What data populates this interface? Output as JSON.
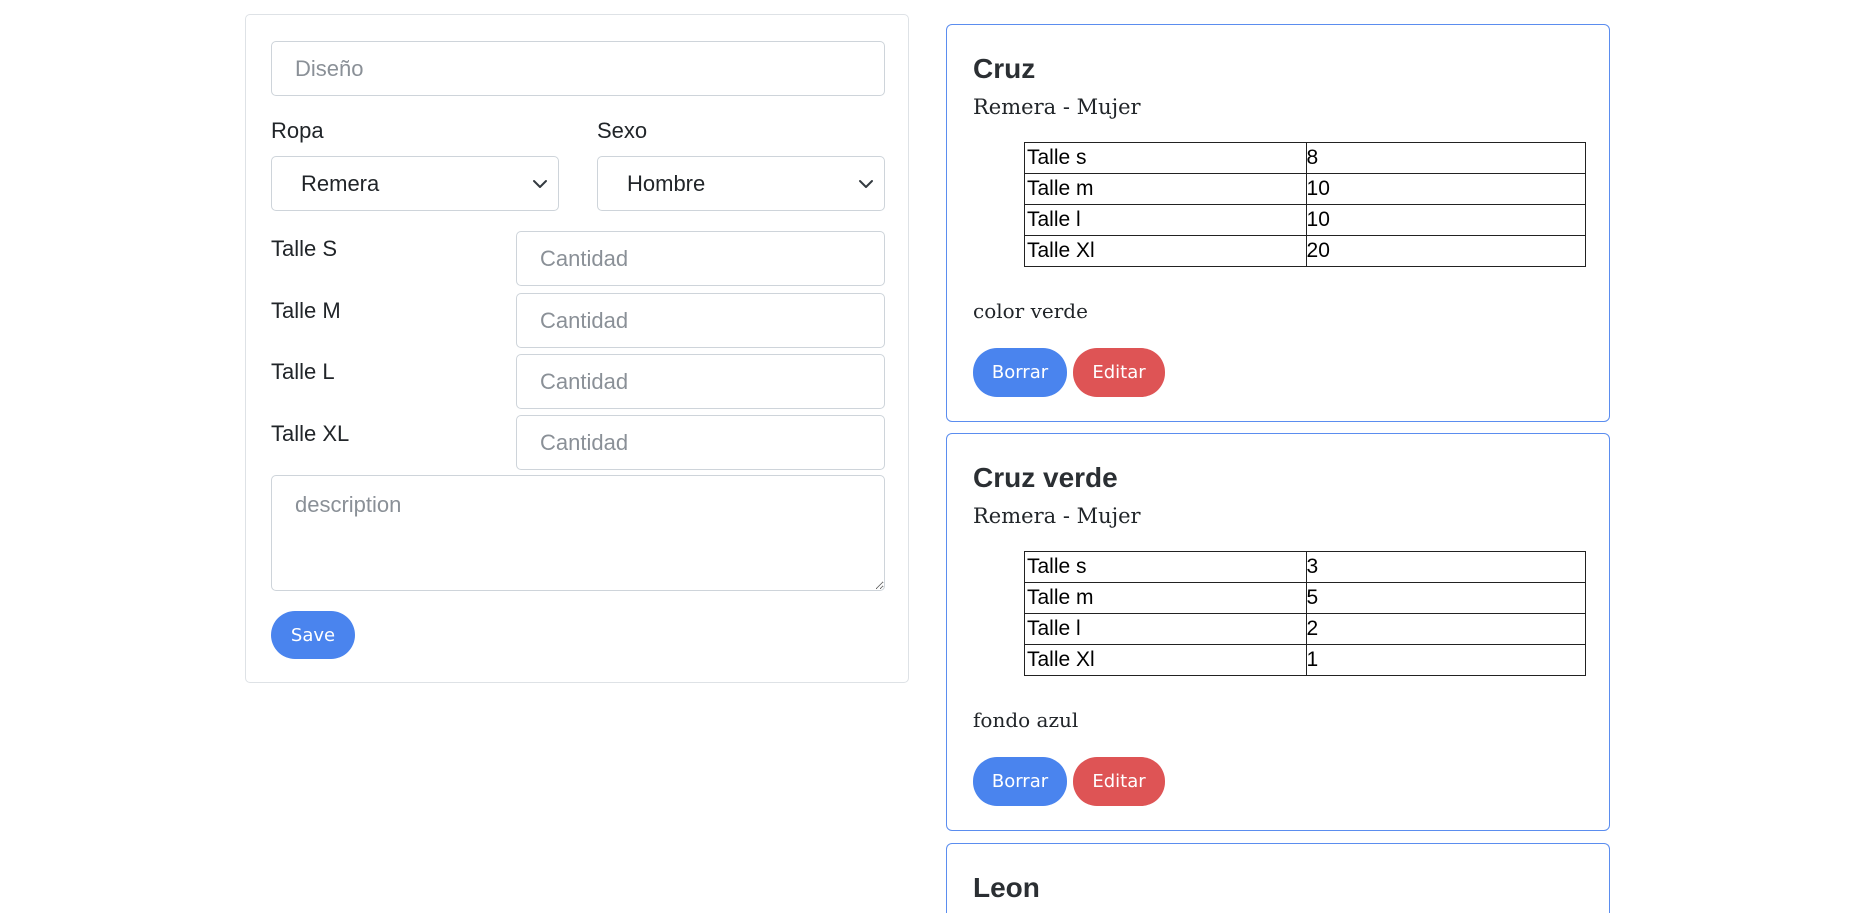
{
  "form": {
    "design_placeholder": "Diseño",
    "ropa_label": "Ropa",
    "ropa_value": "Remera",
    "sexo_label": "Sexo",
    "sexo_value": "Hombre",
    "sizes": [
      {
        "label": "Talle S",
        "placeholder": "Cantidad"
      },
      {
        "label": "Talle M",
        "placeholder": "Cantidad"
      },
      {
        "label": "Talle L",
        "placeholder": "Cantidad"
      },
      {
        "label": "Talle XL",
        "placeholder": "Cantidad"
      }
    ],
    "description_placeholder": "description",
    "save_label": "Save"
  },
  "cards": [
    {
      "title": "Cruz",
      "subtitle": "Remera - Mujer",
      "sizes": [
        {
          "label": "Talle s",
          "qty": "8"
        },
        {
          "label": "Talle m",
          "qty": "10"
        },
        {
          "label": "Talle l",
          "qty": "10"
        },
        {
          "label": "Talle Xl",
          "qty": "20"
        }
      ],
      "note": "color verde",
      "borrar_label": "Borrar",
      "editar_label": "Editar"
    },
    {
      "title": "Cruz verde",
      "subtitle": "Remera - Mujer",
      "sizes": [
        {
          "label": "Talle s",
          "qty": "3"
        },
        {
          "label": "Talle m",
          "qty": "5"
        },
        {
          "label": "Talle l",
          "qty": "2"
        },
        {
          "label": "Talle Xl",
          "qty": "1"
        }
      ],
      "note": "fondo azul",
      "borrar_label": "Borrar",
      "editar_label": "Editar"
    },
    {
      "title": "Leon"
    }
  ],
  "colors": {
    "primary": "#4a84ee",
    "danger": "#de5455",
    "card_border": "#5b8def"
  },
  "icons": {
    "select_arrow": "chevron-down-icon"
  }
}
